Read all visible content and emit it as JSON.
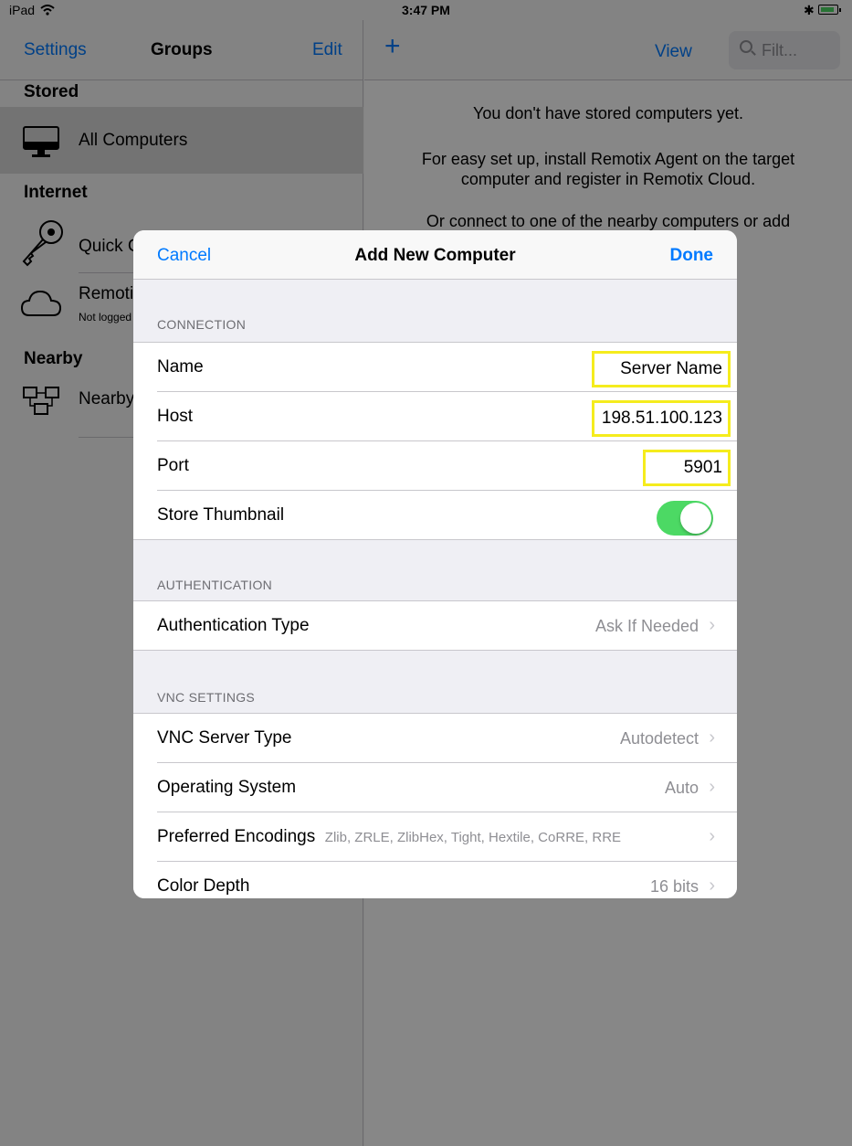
{
  "status_bar": {
    "carrier": "iPad",
    "time": "3:47 PM"
  },
  "sidebar": {
    "nav": {
      "left": "Settings",
      "title": "Groups",
      "right": "Edit"
    },
    "sections": {
      "stored": "Stored",
      "internet": "Internet",
      "nearby": "Nearby"
    },
    "items": {
      "all_computers": "All Computers",
      "quick_connect": "Quick Connect",
      "remotix_cloud": "Remotix Cloud",
      "remotix_cloud_sub": "Not logged in",
      "nearby": "Nearby"
    }
  },
  "detail": {
    "view_label": "View",
    "filter_placeholder": "Filt...",
    "empty_line1": "You don't have stored computers yet.",
    "empty_line2": "For easy set up, install Remotix Agent on the target",
    "empty_line3": "computer and register in Remotix Cloud.",
    "empty_line4": "Or connect to one of the nearby computers or add"
  },
  "modal": {
    "cancel": "Cancel",
    "title": "Add New Computer",
    "done": "Done",
    "connection": {
      "header": "CONNECTION",
      "name_label": "Name",
      "name_value": "Server Name",
      "host_label": "Host",
      "host_value": "198.51.100.123",
      "port_label": "Port",
      "port_value": "5901",
      "thumbnail_label": "Store Thumbnail",
      "thumbnail_on": true
    },
    "authentication": {
      "header": "AUTHENTICATION",
      "type_label": "Authentication Type",
      "type_value": "Ask If Needed"
    },
    "vnc": {
      "header": "VNC SETTINGS",
      "server_type_label": "VNC Server Type",
      "server_type_value": "Autodetect",
      "os_label": "Operating System",
      "os_value": "Auto",
      "encodings_label": "Preferred Encodings",
      "encodings_value": "Zlib, ZRLE, ZlibHex, Tight, Hextile, CoRRE, RRE",
      "color_depth_label": "Color Depth",
      "color_depth_value": "16 bits"
    }
  },
  "colors": {
    "accent": "#007aff",
    "toggle_on": "#4cd964",
    "highlight": "#f5ec1d"
  }
}
